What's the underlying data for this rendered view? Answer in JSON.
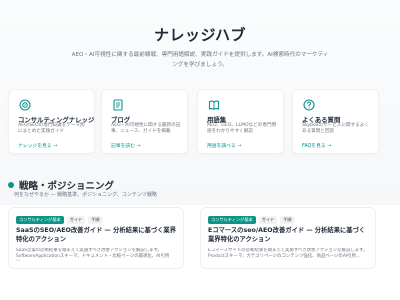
{
  "hero": {
    "title": "ナレッジハブ",
    "subtitle": "AEO・AI可視性に関する最前線戦、専門用語解説、実践ガイドを提供します。AI検索時代のマーケティングを学びましょう。"
  },
  "cards": [
    {
      "icon": "target-icon",
      "title": "コンサルティングナレッジ",
      "desc": "AEO/SEOの専門知識をテーマ別にまとめた実践ガイド",
      "link": "ナレッジを見る →"
    },
    {
      "icon": "document-icon",
      "title": "ブログ",
      "desc": "AEO・AI可視性に関する最新の記事、ニュース、ガイドを掲載",
      "link": "記事を読む →"
    },
    {
      "icon": "book-icon",
      "title": "用語集",
      "desc": "AEO、GEO、LLMOなどの専門用語をわかりやすく解説",
      "link": "用語を調べる →"
    },
    {
      "icon": "question-icon",
      "title": "よくある質問",
      "desc": "Skyboxのサービスに関するよくある質問と回答",
      "link": "FAQを見る →"
    }
  ],
  "section": {
    "title": "戦略・ポジショニング",
    "subtitle": "何をなぜやるか — 戦略基準、ポジショニング、コンテンツ戦略"
  },
  "articles": [
    {
      "badges": [
        "コンサルティング基本",
        "ガイド",
        "手順"
      ],
      "title": "SaaSのSEO/AEO改善ガイド — 分析結果に基づく業界特化のアクション",
      "desc": "SaaS企業の診断結果を踏まえて実施すべき改善アクションを解説します。SoftwareApplicationスキーマ、ドキュメント・比較ページの最適化、AI引用に..."
    },
    {
      "badges": [
        "コンサルティング基本",
        "ガイド",
        "手順"
      ],
      "title": "Eコマースのseo/AEO改善ガイド — 分析結果に基づく業界特化のアクション",
      "desc": "Eコマースサイトの診断結果を踏まえて実施すべき改善アクションを解説します。Productスキーマ、カテゴリページのコンテンツ強化、商品ページのAI引用..."
    }
  ],
  "colors": {
    "accent": "#0d9488",
    "background": "#ffffff"
  }
}
